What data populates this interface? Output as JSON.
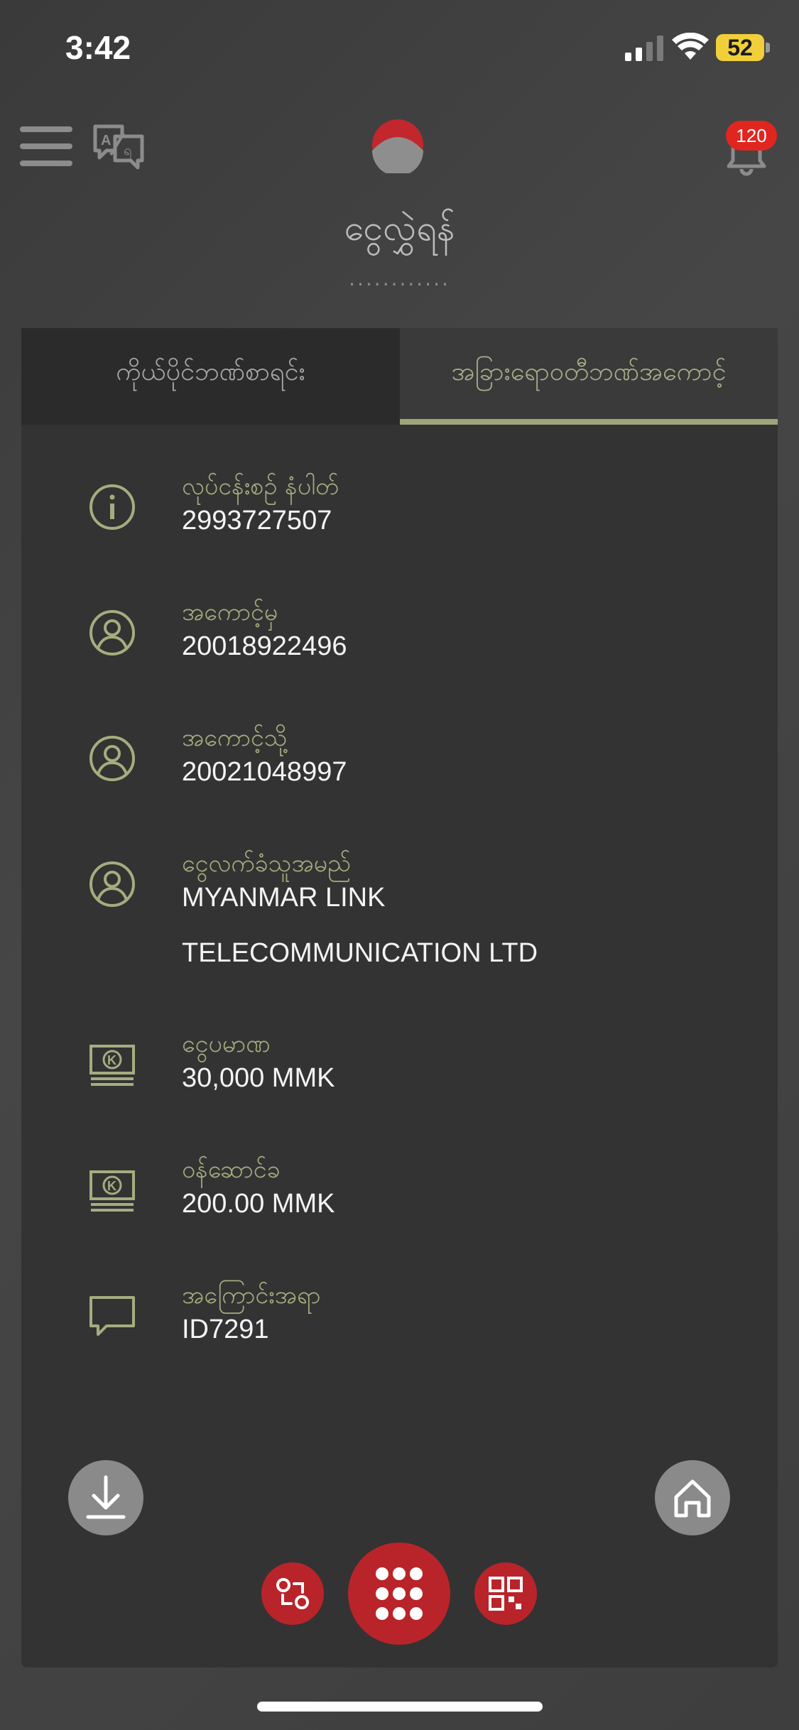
{
  "status_bar": {
    "time": "3:42",
    "battery": "52"
  },
  "header": {
    "notification_count": "120",
    "title": "ငွေလွှဲရန်",
    "subtitle": "............"
  },
  "tabs": [
    {
      "label": "ကိုယ်ပိုင်ဘဏ်စာရင်း",
      "active": false
    },
    {
      "label": "အခြားရောဝတီဘဏ်အကောင့်",
      "active": true
    }
  ],
  "details": [
    {
      "icon": "info-icon",
      "label": "လုပ်ငန်းစဉ် နံပါတ်",
      "value": "2993727507"
    },
    {
      "icon": "user-icon",
      "label": "အကောင့်မှ",
      "value": "20018922496"
    },
    {
      "icon": "user-icon",
      "label": "အကောင့်သို့",
      "value": "20021048997"
    },
    {
      "icon": "user-icon",
      "label": "ငွေလက်ခံသူအမည်",
      "value": "MYANMAR LINK",
      "value2": "TELECOMMUNICATION LTD"
    },
    {
      "icon": "money-icon",
      "label": "ငွေပမာဏ",
      "value": "30,000 MMK"
    },
    {
      "icon": "money-icon",
      "label": "ဝန်ဆောင်ခ",
      "value": "200.00 MMK"
    },
    {
      "icon": "comment-icon",
      "label": "အကြောင်းအရာ",
      "value": "ID7291"
    }
  ],
  "colors": {
    "accent_olive": "#a4ad7e",
    "brand_red": "#b9242a",
    "badge_red": "#e0261f"
  }
}
